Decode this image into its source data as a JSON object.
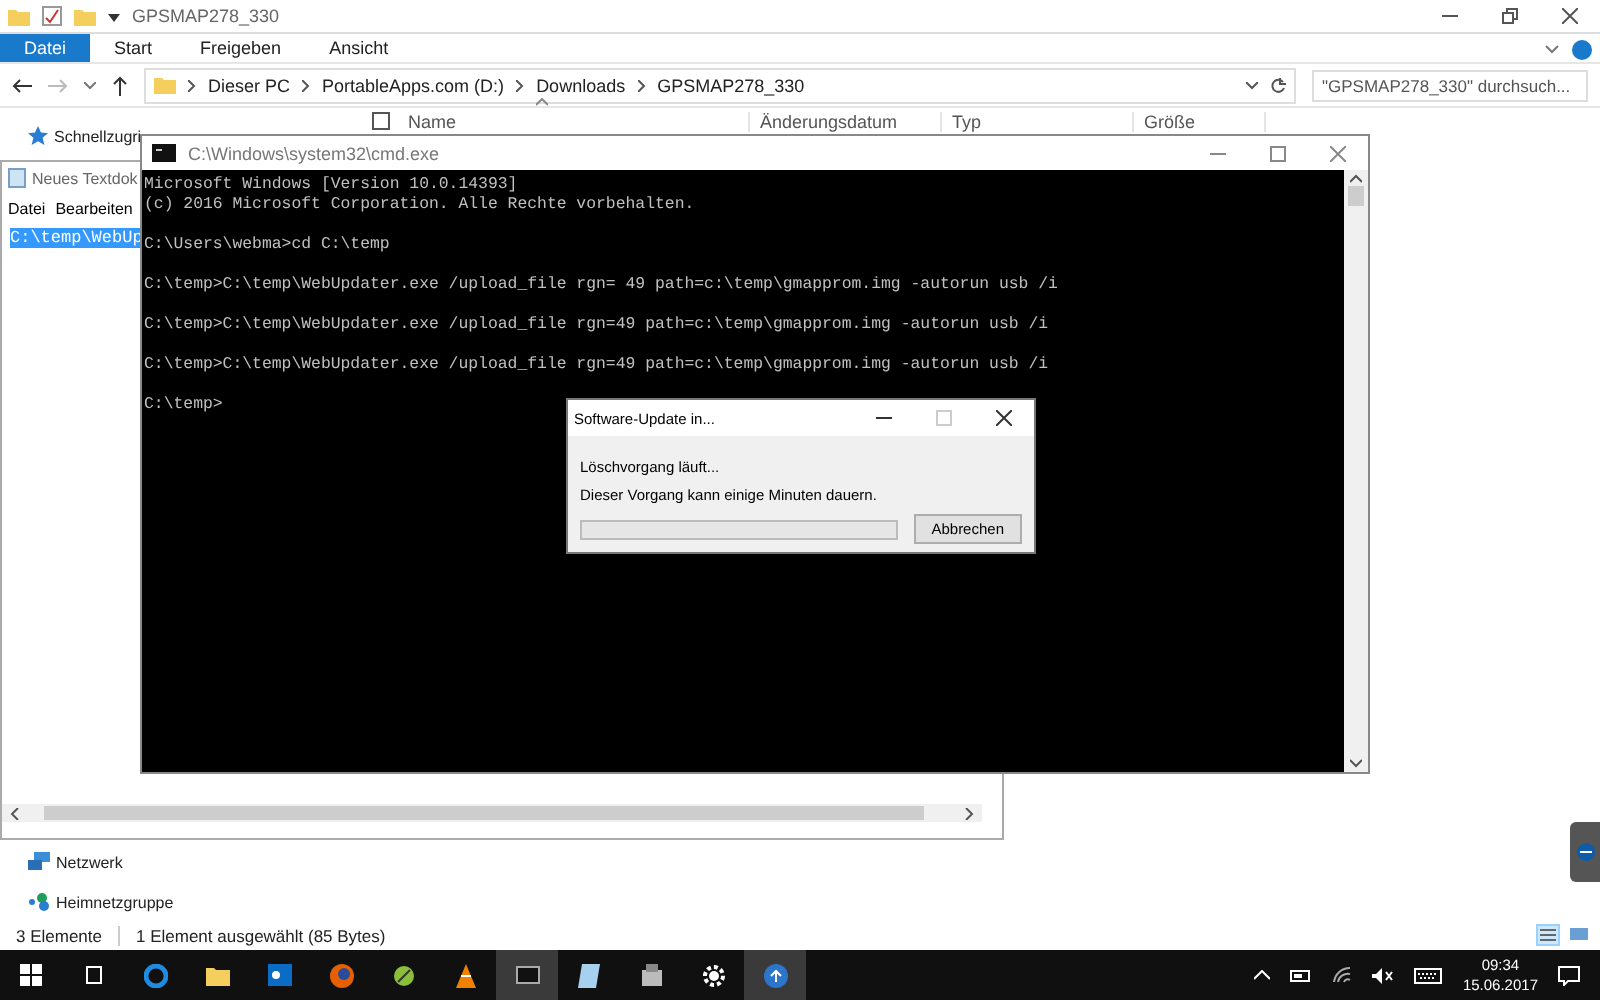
{
  "explorer": {
    "title": "GPSMAP278_330",
    "ribbon_tabs": [
      {
        "label": "Datei",
        "selected": true
      },
      {
        "label": "Start",
        "selected": false
      },
      {
        "label": "Freigeben",
        "selected": false
      },
      {
        "label": "Ansicht",
        "selected": false
      }
    ],
    "breadcrumb": [
      "Dieser PC",
      "PortableApps.com (D:)",
      "Downloads",
      "GPSMAP278_330"
    ],
    "search": {
      "placeholder": "\"GPSMAP278_330\" durchsuch..."
    },
    "select_all": {
      "checked": false
    },
    "columns": [
      "Name",
      "Änderungsdatum",
      "Typ",
      "Größe"
    ],
    "nav_items": [
      {
        "label": "Schnellzugri",
        "kind": "star"
      },
      {
        "label": "Netzwerk",
        "kind": "network"
      },
      {
        "label": "Heimnetzgruppe",
        "kind": "homegroup"
      }
    ],
    "status": [
      "3 Elemente",
      "1 Element ausgewählt (85 Bytes)"
    ]
  },
  "notepad": {
    "title": "Neues Textdok",
    "menu": [
      "Datei",
      "Bearbeiten"
    ],
    "selected_text": "C:\\temp\\WebUp"
  },
  "console": {
    "title": "C:\\Windows\\system32\\cmd.exe",
    "blocks": [
      [
        "Microsoft Windows [Version 10.0.14393]",
        "(c) 2016 Microsoft Corporation. Alle Rechte vorbehalten."
      ],
      [
        "C:\\Users\\webma>cd C:\\temp"
      ],
      [
        "C:\\temp>C:\\temp\\WebUpdater.exe /upload_file rgn= 49 path=c:\\temp\\gmapprom.img -autorun usb /i"
      ],
      [
        "C:\\temp>C:\\temp\\WebUpdater.exe /upload_file rgn=49 path=c:\\temp\\gmapprom.img -autorun usb /i"
      ],
      [
        "C:\\temp>C:\\temp\\WebUpdater.exe /upload_file rgn=49 path=c:\\temp\\gmapprom.img -autorun usb /i"
      ],
      [
        "C:\\temp>"
      ]
    ]
  },
  "dialog": {
    "title": "Software-Update in...",
    "status": "Löschvorgang läuft...",
    "message": "Dieser Vorgang kann einige Minuten dauern.",
    "progress": {
      "level": 0
    },
    "button": "Abbrechen"
  },
  "taskbar": {
    "time": "09:34",
    "date": "15.06.2017"
  }
}
